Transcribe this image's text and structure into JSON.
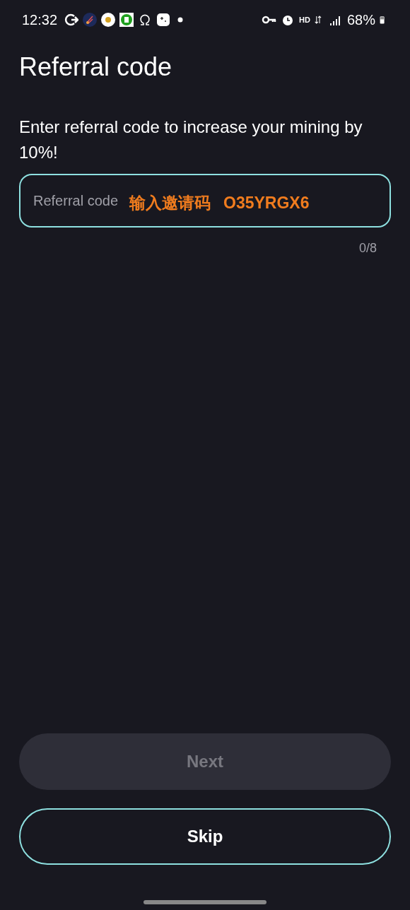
{
  "status_bar": {
    "time": "12:32",
    "hd": "HD",
    "battery": "68%"
  },
  "title": "Referral code",
  "description": "Enter referral code to increase your mining by 10%!",
  "field": {
    "placeholder": "Referral code",
    "counter": "0/8",
    "focused": true
  },
  "overlay_annotation": {
    "label": "输入邀请码",
    "code": "O35YRGX6"
  },
  "buttons": [
    {
      "kind": "filled",
      "label": "Next",
      "disabled": true
    },
    {
      "kind": "outline",
      "label": "Skip",
      "disabled": false
    }
  ]
}
